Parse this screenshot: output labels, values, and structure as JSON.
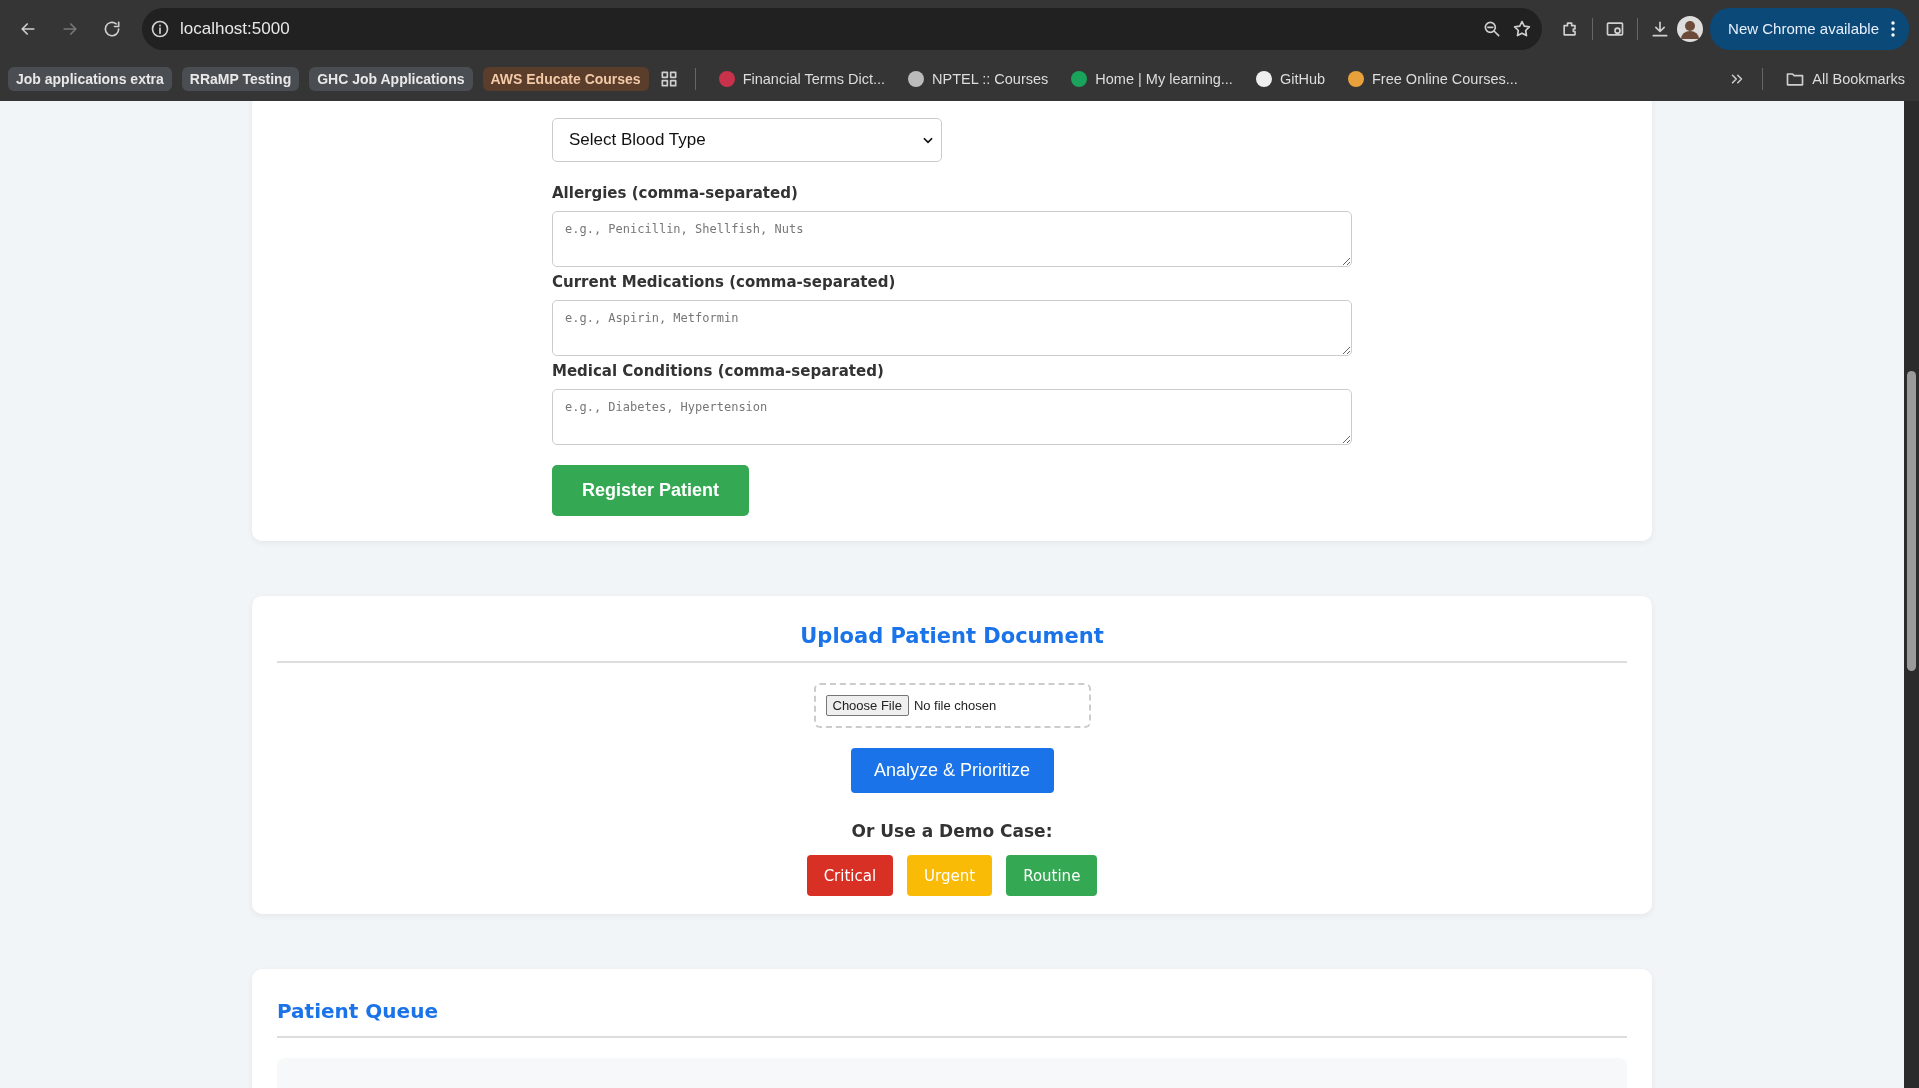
{
  "browser": {
    "url": "localhost:5000",
    "update_button": "New Chrome available",
    "bookmarks": [
      {
        "kind": "group",
        "label": "Job applications extra",
        "color": "#4a4d52"
      },
      {
        "kind": "group",
        "label": "RRaMP Testing",
        "color": "#4a4d52"
      },
      {
        "kind": "group",
        "label": "GHC Job Applications",
        "color": "#4a4d52"
      },
      {
        "kind": "group",
        "label": "AWS Educate Courses",
        "color": "#5a3e2b"
      },
      {
        "kind": "apps"
      },
      {
        "kind": "link",
        "label": "Financial Terms Dict..."
      },
      {
        "kind": "link",
        "label": "NPTEL :: Courses"
      },
      {
        "kind": "link",
        "label": "Home | My learning..."
      },
      {
        "kind": "link",
        "label": "GitHub"
      },
      {
        "kind": "link",
        "label": "Free Online Courses..."
      }
    ],
    "all_bookmarks": "All Bookmarks"
  },
  "registration": {
    "select": {
      "value": "Select Blood Type"
    },
    "fields": [
      {
        "label": "Allergies (comma-separated)",
        "placeholder": "e.g., Penicillin, Shellfish, Nuts"
      },
      {
        "label": "Current Medications (comma-separated)",
        "placeholder": "e.g., Aspirin, Metformin"
      },
      {
        "label": "Medical Conditions (comma-separated)",
        "placeholder": "e.g., Diabetes, Hypertension"
      }
    ],
    "submit": "Register Patient"
  },
  "upload": {
    "title": "Upload Patient Document",
    "file_button": "Choose File",
    "file_status": "No file chosen",
    "analyze": "Analyze & Prioritize",
    "demo_heading": "Or Use a Demo Case:",
    "demo_cases": [
      {
        "label": "Critical",
        "color": "#d93025"
      },
      {
        "label": "Urgent",
        "color": "#f9bb06"
      },
      {
        "label": "Routine",
        "color": "#34a853"
      }
    ]
  },
  "queue": {
    "title": "Patient Queue"
  }
}
